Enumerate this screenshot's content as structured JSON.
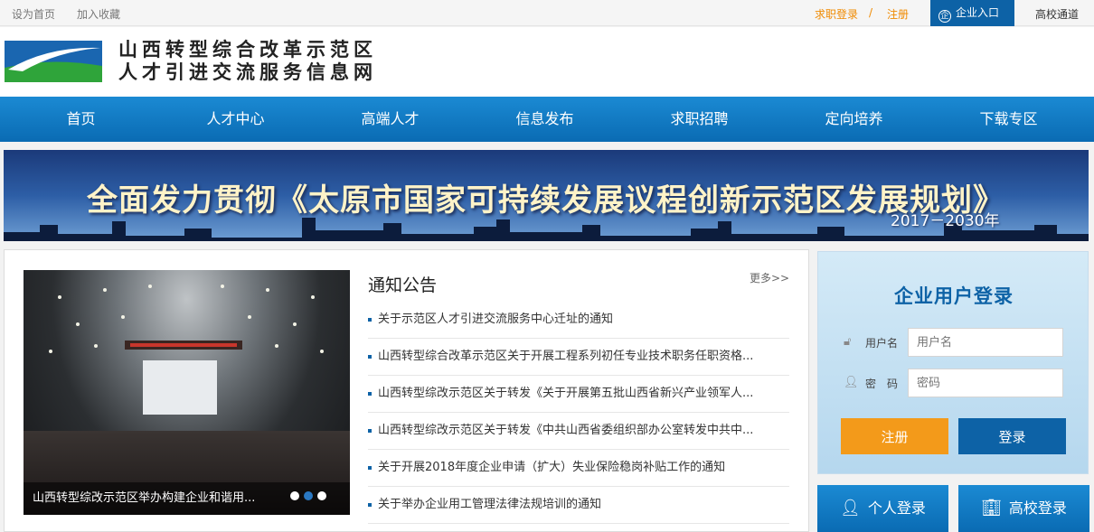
{
  "topbar": {
    "set_home": "设为首页",
    "add_favorite": "加入收藏",
    "job_login": "求职登录",
    "separator": "/",
    "register": "注册",
    "enterprise_entry": "企业入口",
    "enterprise_icon_text": "企",
    "school_channel": "高校通道"
  },
  "header": {
    "site_name_line1": "山西转型综合改革示范区",
    "site_name_line2": "人才引进交流服务信息网"
  },
  "nav": {
    "items": [
      {
        "label": "首页"
      },
      {
        "label": "人才中心"
      },
      {
        "label": "高端人才"
      },
      {
        "label": "信息发布"
      },
      {
        "label": "求职招聘"
      },
      {
        "label": "定向培养"
      },
      {
        "label": "下载专区"
      }
    ]
  },
  "banner": {
    "title": "全面发力贯彻《太原市国家可持续发展议程创新示范区发展规划》",
    "years": "2017－2030年"
  },
  "slider": {
    "caption": "山西转型综改示范区举办构建企业和谐用...",
    "slide_count": 3,
    "active_index": 1
  },
  "notices": {
    "title": "通知公告",
    "more": "更多>>",
    "items": [
      "关于示范区人才引进交流服务中心迁址的通知",
      "山西转型综合改革示范区关于开展工程系列初任专业技术职务任职资格...",
      "山西转型综改示范区关于转发《关于开展第五批山西省新兴产业领军人...",
      "山西转型综改示范区关于转发《中共山西省委组织部办公室转发中共中...",
      "关于开展2018年度企业申请（扩大）失业保险稳岗补贴工作的通知",
      "关于举办企业用工管理法律法规培训的通知"
    ]
  },
  "login": {
    "title": "企业用户登录",
    "username_label": "用户名",
    "username_placeholder": "用户名",
    "password_label": "密　码",
    "password_placeholder": "密码",
    "register_button": "注册",
    "login_button": "登录"
  },
  "side_buttons": {
    "personal_login": "个人登录",
    "school_login": "高校登录"
  },
  "colors": {
    "primary_blue": "#0d62a6",
    "nav_blue": "#1b8ad3",
    "orange": "#f39a1a",
    "link_orange": "#f08a00"
  }
}
